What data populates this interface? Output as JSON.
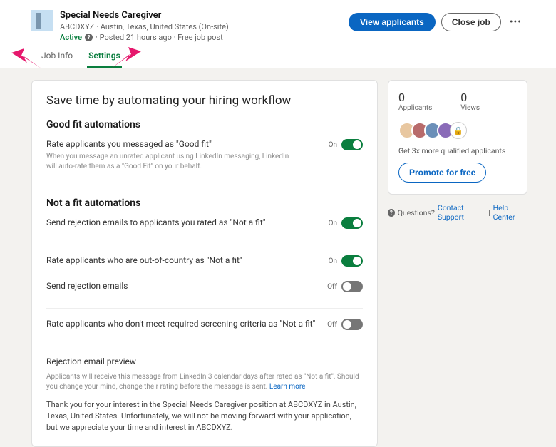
{
  "job": {
    "title": "Special Needs Caregiver",
    "company_location": "ABCDXYZ · Austin, Texas, United States (On-site)",
    "status": "Active",
    "meta": "· Posted 21 hours ago · Free job post"
  },
  "actions": {
    "view_applicants": "View applicants",
    "close_job": "Close job"
  },
  "tabs": {
    "job_info": "Job Info",
    "settings": "Settings"
  },
  "main": {
    "heading": "Save time by automating your hiring workflow",
    "good_fit_title": "Good fit automations",
    "good_fit_rate_label": "Rate applicants you messaged as \"Good fit\"",
    "good_fit_rate_desc": "When you message an unrated applicant using LinkedIn messaging, LinkedIn will auto-rate them as a \"Good Fit\" on your behalf.",
    "not_fit_title": "Not a fit automations",
    "reject_email_label": "Send rejection emails to applicants you rated as \"Not a fit\"",
    "ooc_label": "Rate applicants who are out-of-country as \"Not a fit\"",
    "send_reject_label": "Send rejection emails",
    "screening_label": "Rate applicants who don't meet required screening criteria as \"Not a fit\"",
    "preview_title": "Rejection email preview",
    "preview_note": "Applicants will receive this message from LinkedIn 3 calendar days after rated as \"Not a fit\". Should you change your mind, change their rating before the message is sent. ",
    "learn_more": "Learn more",
    "preview_body": "Thank you for your interest in the Special Needs Caregiver position at ABCDXYZ in Austin, Texas, United States. Unfortunately, we will not be moving forward with your application, but we appreciate your time and interest in ABCDXYZ.",
    "on": "On",
    "off": "Off"
  },
  "side": {
    "applicants_count": "0",
    "applicants_label": "Applicants",
    "views_count": "0",
    "views_label": "Views",
    "qualified_note": "Get 3x more qualified applicants",
    "promote": "Promote for free",
    "questions": "Questions?",
    "contact_support": "Contact Support",
    "help_center": "Help Center",
    "sep": " | "
  },
  "toggles": {
    "good_fit_rate": true,
    "reject_email": true,
    "ooc": true,
    "send_reject": false,
    "screening": false
  }
}
